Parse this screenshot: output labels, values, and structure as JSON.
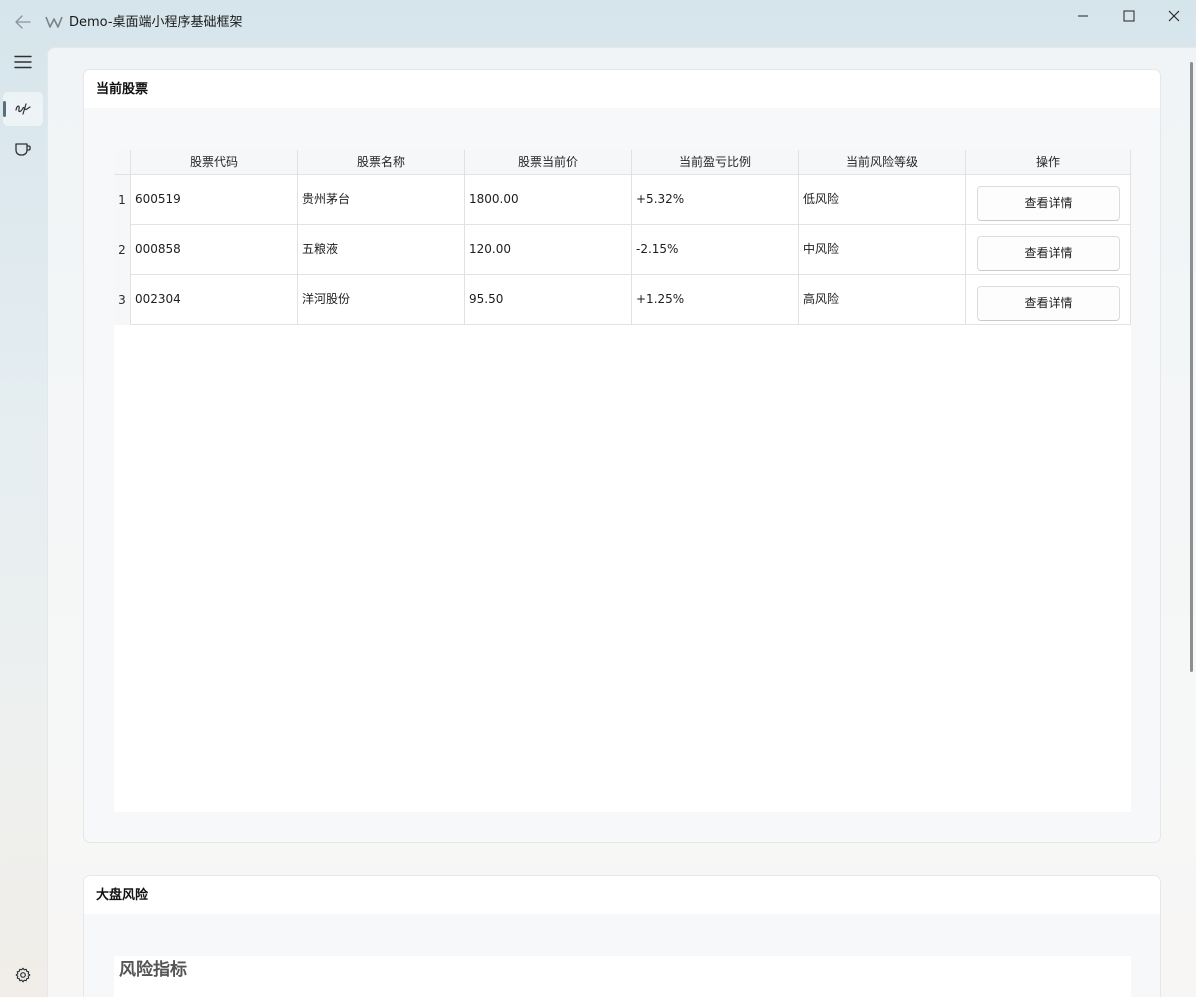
{
  "app": {
    "title": "Demo-桌面端小程序基础框架"
  },
  "icons": {
    "back": "back-arrow-icon",
    "logo": "app-logo-icon",
    "minimize": "minimize-icon",
    "maximize": "maximize-icon",
    "close": "close-icon",
    "menu": "hamburger-menu-icon",
    "signature": "signature-icon",
    "cup": "cup-icon",
    "settings": "gear-icon"
  },
  "stocks_card": {
    "title": "当前股票",
    "columns": [
      "股票代码",
      "股票名称",
      "股票当前价",
      "当前盈亏比例",
      "当前风险等级",
      "操作"
    ],
    "rows": [
      {
        "index": "1",
        "code": "600519",
        "name": "贵州茅台",
        "price": "1800.00",
        "ratio": "+5.32%",
        "risk": "低风险",
        "action": "查看详情"
      },
      {
        "index": "2",
        "code": "000858",
        "name": "五粮液",
        "price": "120.00",
        "ratio": "-2.15%",
        "risk": "中风险",
        "action": "查看详情"
      },
      {
        "index": "3",
        "code": "002304",
        "name": "洋河股份",
        "price": "95.50",
        "ratio": "+1.25%",
        "risk": "高风险",
        "action": "查看详情"
      }
    ]
  },
  "market_card": {
    "title": "大盘风险",
    "section_title": "风险指标"
  }
}
